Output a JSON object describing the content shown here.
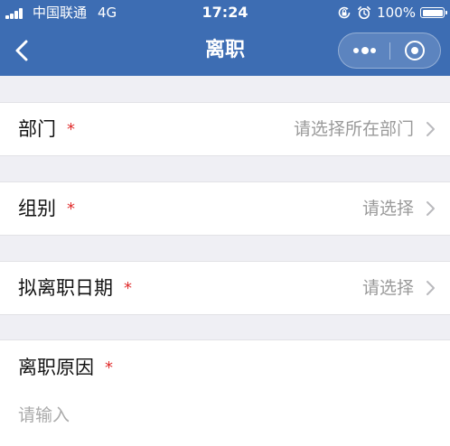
{
  "status_bar": {
    "carrier": "中国联通",
    "network": "4G",
    "time": "17:24",
    "battery": "100%",
    "icons": [
      "signal-icon",
      "orientation-lock-icon",
      "alarm-icon",
      "battery-icon"
    ]
  },
  "nav": {
    "title": "离职",
    "back_icon": "chevron-left-icon",
    "more_icon": "more-dots-icon",
    "close_icon": "target-close-icon"
  },
  "form": {
    "department": {
      "label": "部门",
      "required_mark": "*",
      "value": "请选择所在部门"
    },
    "group": {
      "label": "组别",
      "required_mark": "*",
      "value": "请选择"
    },
    "leave_date": {
      "label": "拟离职日期",
      "required_mark": "*",
      "value": "请选择"
    },
    "reason": {
      "label": "离职原因",
      "required_mark": "*",
      "placeholder": "请输入"
    }
  },
  "colors": {
    "header_bg": "#3d6db3",
    "page_bg": "#efeff4",
    "required": "#e02e2e",
    "placeholder": "#9a9a9a"
  }
}
